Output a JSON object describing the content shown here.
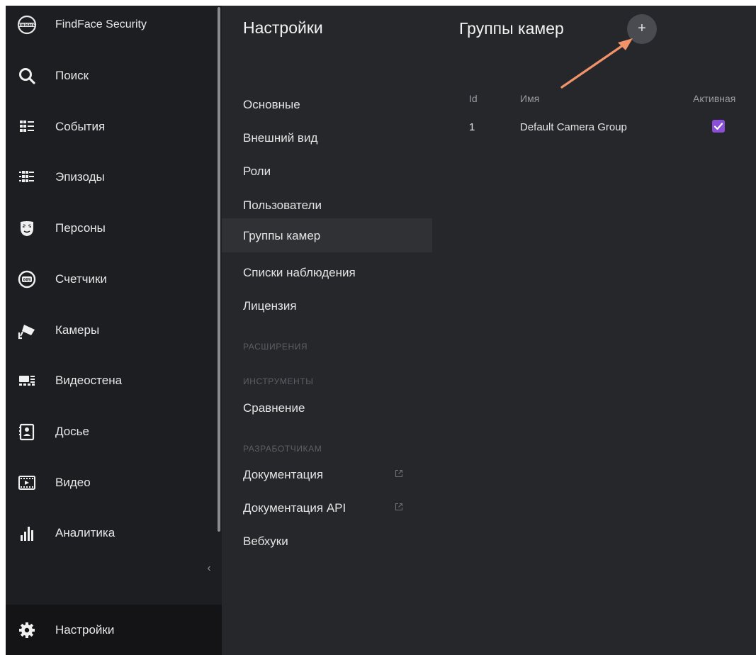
{
  "app": {
    "brand": "FindFace Security",
    "brand_logo_text": "FINDFACE"
  },
  "nav": {
    "items": [
      {
        "label": "Поиск",
        "icon": "search-icon"
      },
      {
        "label": "События",
        "icon": "events-icon"
      },
      {
        "label": "Эпизоды",
        "icon": "episodes-icon"
      },
      {
        "label": "Персоны",
        "icon": "persons-mask-icon"
      },
      {
        "label": "Счетчики",
        "icon": "counter-icon"
      },
      {
        "label": "Камеры",
        "icon": "camera-icon"
      },
      {
        "label": "Видеостена",
        "icon": "videowall-icon"
      },
      {
        "label": "Досье",
        "icon": "dossier-icon"
      },
      {
        "label": "Видео",
        "icon": "video-icon"
      },
      {
        "label": "Аналитика",
        "icon": "analytics-icon"
      }
    ],
    "collapse": "‹",
    "settings": {
      "label": "Настройки",
      "icon": "gear-icon"
    }
  },
  "menu": {
    "title": "Настройки",
    "main_items": [
      "Основные",
      "Внешний вид",
      "Роли",
      "Пользователи",
      "Группы камер",
      "Списки наблюдения",
      "Лицензия"
    ],
    "active": "Группы камер",
    "sections": {
      "extensions": "РАСШИРЕНИЯ",
      "tools": "ИНСТРУМЕНТЫ",
      "developers": "РАЗРАБОТЧИКАМ"
    },
    "tools_items": [
      "Сравнение"
    ],
    "dev_items": [
      "Документация",
      "Документация API",
      "Вебхуки"
    ]
  },
  "content": {
    "title": "Группы камер",
    "add_button": "+",
    "table": {
      "headers": {
        "id": "Id",
        "name": "Имя",
        "active": "Активная"
      },
      "rows": [
        {
          "id": "1",
          "name": "Default Camera Group",
          "active": true
        }
      ]
    }
  },
  "colors": {
    "accent_checkbox": "#8a4fd6",
    "annotation_arrow": "#f0926a",
    "nav_bg": "#1d1e22",
    "panel_bg": "#26272b"
  }
}
